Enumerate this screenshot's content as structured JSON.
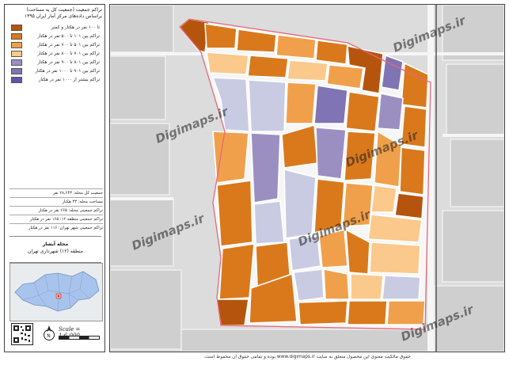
{
  "legend": {
    "title_line1": "تراکم جمعیت (جمعیت کل به مساحت)",
    "title_line2": "براساس داده‌های مرکز آمار ایران ۱۳۹۵",
    "items": [
      {
        "label": "تا ۱۰۰ نفر در هکتار و کمتر",
        "color": "#b5550d"
      },
      {
        "label": "تراکم بین ۱۰۱ تا ۵۰۰ نفر در هکتار",
        "color": "#d9791c"
      },
      {
        "label": "تراکم بین ۵۰۱ تا ۷۰۰ نفر در هکتار",
        "color": "#f0a04b"
      },
      {
        "label": "تراکم بین ۷۰۱ تا ۸۰۰ نفر در هکتار",
        "color": "#fbc98b"
      },
      {
        "label": "تراکم بین ۸۰۱ تا ۹۰۰ نفر در هکتار",
        "color": "#9b8fc2"
      },
      {
        "label": "تراکم بین ۹۰۱ تا ۱۰۰۰ نفر در هکتار",
        "color": "#8074b4"
      },
      {
        "label": "تراکم بیشتر از ۱۰۰۰ نفر در هکتار",
        "color": "#5b58a8"
      }
    ],
    "stats": [
      {
        "label": "جمعیت کل محله:",
        "value": "۲۸,۶۴۳ نفر"
      },
      {
        "label": "مساحت محله:",
        "value": "۴۳ هکتار"
      },
      {
        "label": "تراکم جمعیتی محله:",
        "value": "۶۶۵ نفر در هکتار"
      },
      {
        "label": "تراکم جمعیتی منطقه ۱۲:",
        "value": "۱۶۵ نفر در هکتار"
      },
      {
        "label": "تراکم جمعیتی شهر تهران:",
        "value": "۱۱۶ نفر در هکتار"
      }
    ],
    "region_name": "محله آبشار",
    "region_sub": "منطقه (۱۲) شهرداری تهران",
    "scale": "Scale = 1:6,000"
  },
  "map": {
    "watermark": "Digimaps.ir",
    "credit": "حقوق مالکیت معنوی این محصول متعلق به سایت www.digimaps.ir بوده و تمامی حقوق آن محفوظ است."
  },
  "colors": {
    "boundary": "#e8667a",
    "road": "#f7f7f7",
    "bg": "#d8d8d8",
    "light": "#c9cbe3"
  }
}
